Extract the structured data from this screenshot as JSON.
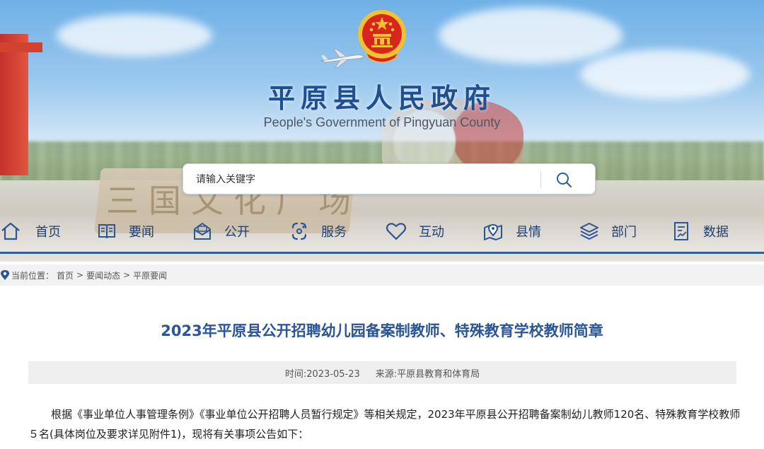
{
  "header": {
    "title": "平原县人民政府",
    "subtitle": "People's Government of Pingyuan County",
    "emblem_icon": "national-emblem-icon",
    "banner_stone_text": "三国文化广场"
  },
  "search": {
    "placeholder": "请输入关键字",
    "icon": "search-icon"
  },
  "nav": {
    "items": [
      {
        "label": "首页",
        "icon": "home-icon"
      },
      {
        "label": "要闻",
        "icon": "book-icon"
      },
      {
        "label": "公开",
        "icon": "envelope-icon"
      },
      {
        "label": "服务",
        "icon": "service-icon"
      },
      {
        "label": "互动",
        "icon": "heart-icon"
      },
      {
        "label": "县情",
        "icon": "map-pin-icon"
      },
      {
        "label": "部门",
        "icon": "layers-icon"
      },
      {
        "label": "数据",
        "icon": "data-icon"
      }
    ]
  },
  "breadcrumb": {
    "prefix": "当前位置：",
    "items": [
      "首页",
      "要闻动态",
      "平原要闻"
    ],
    "separator": ">"
  },
  "article": {
    "title": "2023年平原县公开招聘幼儿园备案制教师、特殊教育学校教师简章",
    "time_label": "时间:2023-05-23",
    "source_label": "来源:平原县教育和体育局",
    "paragraph": "根据《事业单位人事管理条例》《事业单位公开招聘人员暂行规定》等相关规定，2023年平原县公开招聘备案制幼儿教师120名、特殊教育学校教师５名(具体岗位及要求详见附件1)，现将有关事项公告如下："
  },
  "colors": {
    "brand_blue": "#1f4f8e",
    "title_blue": "#2a5597",
    "nav_line": "#2f5e9a",
    "emblem_red": "#d8261f",
    "emblem_gold": "#f2c230"
  }
}
